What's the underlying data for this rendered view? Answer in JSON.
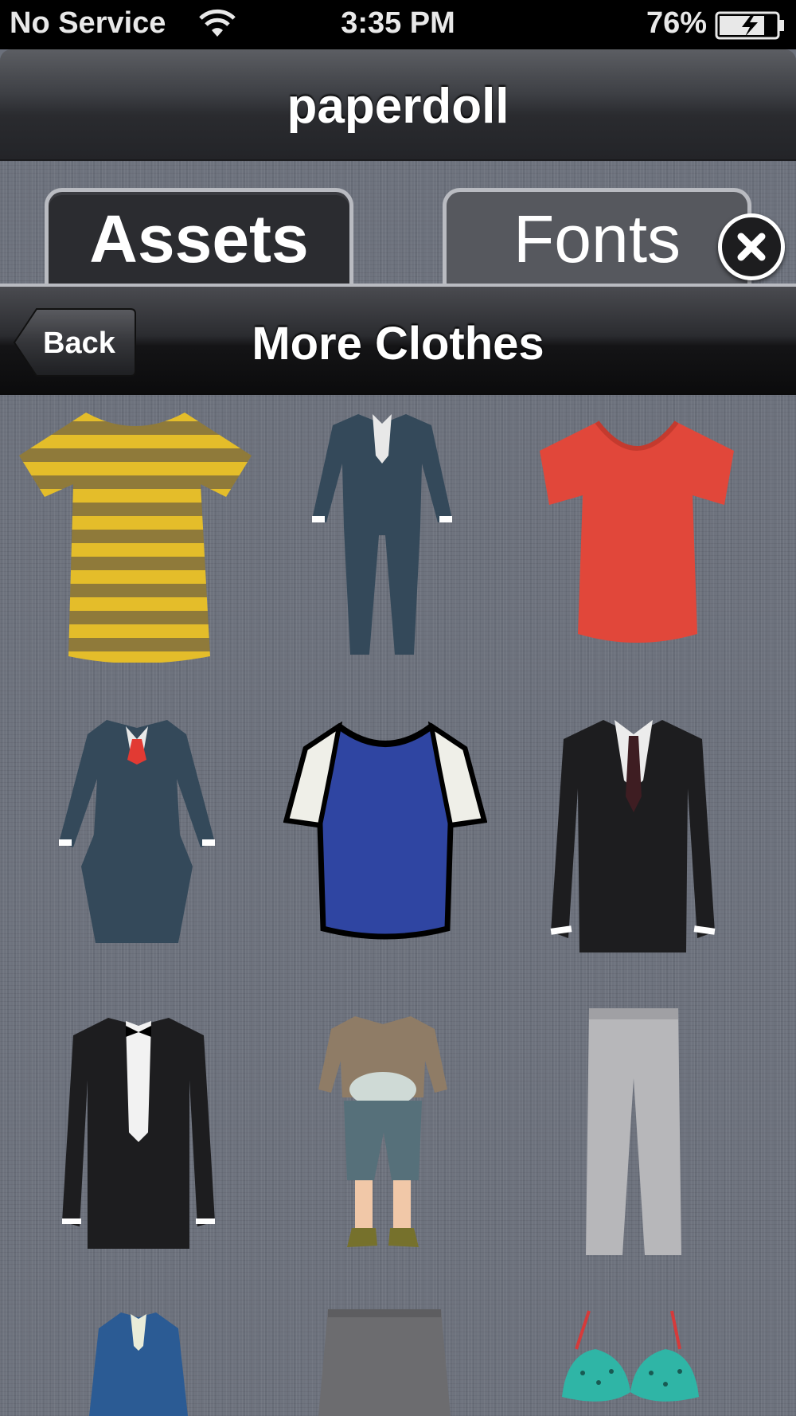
{
  "status_bar": {
    "carrier": "No Service",
    "time": "3:35 PM",
    "battery_percent": "76%",
    "wifi_icon": "wifi-icon",
    "battery_icon": "battery-charging-icon"
  },
  "nav": {
    "title": "paperdoll"
  },
  "tabs": [
    {
      "label": "Assets",
      "selected": true
    },
    {
      "label": "Fonts",
      "selected": false
    }
  ],
  "sub_nav": {
    "back_label": "Back",
    "title": "More Clothes"
  },
  "grid": {
    "items": [
      {
        "name": "yellow-striped-tshirt"
      },
      {
        "name": "navy-suit"
      },
      {
        "name": "red-tshirt"
      },
      {
        "name": "navy-skirt-suit"
      },
      {
        "name": "blue-raglan-tshirt"
      },
      {
        "name": "black-suit-jacket"
      },
      {
        "name": "tuxedo-jacket"
      },
      {
        "name": "casual-outfit-with-shorts"
      },
      {
        "name": "grey-trousers"
      },
      {
        "name": "blue-suit"
      },
      {
        "name": "grey-skirt"
      },
      {
        "name": "teal-bikini-top"
      }
    ]
  },
  "colors": {
    "accent_tab_selected": "#2b2c30",
    "linen_background": "#6e737e"
  }
}
